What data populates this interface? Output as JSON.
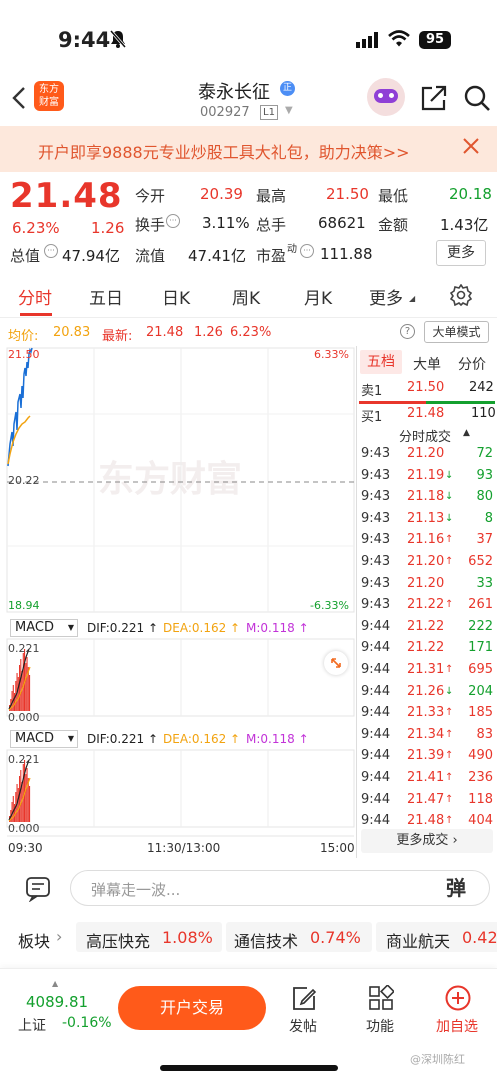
{
  "status": {
    "time": "9:44",
    "battery": "95"
  },
  "nav": {
    "name": "泰永长征",
    "badge": "正",
    "code": "002927",
    "level": "L1"
  },
  "banner": {
    "text": "开户即享9888元专业炒股工具大礼包，助力决策>>"
  },
  "quote": {
    "price": "21.48",
    "pct": "6.23%",
    "chg": "1.26",
    "rows": [
      [
        {
          "label": "今开",
          "value": "20.39",
          "color": "red"
        },
        {
          "label": "最高",
          "value": "21.50",
          "color": "red"
        },
        {
          "label": "最低",
          "value": "20.18",
          "color": "green"
        }
      ],
      [
        {
          "label": "换手",
          "value": "3.11%",
          "color": "dark"
        },
        {
          "label": "总手",
          "value": "68621",
          "color": "dark"
        },
        {
          "label": "金额",
          "value": "1.43亿",
          "color": "dark"
        }
      ],
      [
        {
          "label": "总值",
          "value": "47.94亿",
          "color": "dark"
        },
        {
          "label": "流值",
          "value": "47.41亿",
          "color": "dark"
        },
        {
          "label": "市盈",
          "sup": "动",
          "value": "111.88",
          "color": "dark"
        }
      ]
    ],
    "more": "更多"
  },
  "tabs": [
    "分时",
    "五日",
    "日K",
    "周K",
    "月K",
    "更多"
  ],
  "avg": {
    "avg_label": "均价:",
    "avg_value": "20.83",
    "last_label": "最新:",
    "last_value": "21.48",
    "chg": "1.26",
    "pct": "6.23%",
    "bigorder": "大单模式"
  },
  "chart": {
    "y_top": "21.50",
    "y_mid": "20.22",
    "y_bot": "18.94",
    "pct_top": "6.33%",
    "pct_bot": "-6.33%",
    "macd": {
      "name": "MACD",
      "dif": "DIF:0.221 ↑",
      "dea": "DEA:0.162 ↑",
      "m": "M:0.118 ↑",
      "y_top": "0.221",
      "y_bot": "0.000"
    },
    "x_labels": [
      "09:30",
      "11:30/13:00",
      "15:00"
    ],
    "watermark": "东方财富"
  },
  "side": {
    "tabs": [
      "五档",
      "大单",
      "分价"
    ],
    "sell": {
      "label": "卖1",
      "price": "21.50",
      "vol": "242"
    },
    "buy": {
      "label": "买1",
      "price": "21.48",
      "vol": "110"
    },
    "trades_title": "分时成交",
    "trades": [
      {
        "t": "9:43",
        "p": "21.20",
        "a": "",
        "v": "72",
        "c": "green"
      },
      {
        "t": "9:43",
        "p": "21.19",
        "a": "↓",
        "v": "93",
        "c": "green"
      },
      {
        "t": "9:43",
        "p": "21.18",
        "a": "↓",
        "v": "80",
        "c": "green"
      },
      {
        "t": "9:43",
        "p": "21.13",
        "a": "↓",
        "v": "8",
        "c": "green"
      },
      {
        "t": "9:43",
        "p": "21.16",
        "a": "↑",
        "v": "37",
        "c": "red"
      },
      {
        "t": "9:43",
        "p": "21.20",
        "a": "↑",
        "v": "652",
        "c": "red"
      },
      {
        "t": "9:43",
        "p": "21.20",
        "a": "",
        "v": "33",
        "c": "green"
      },
      {
        "t": "9:43",
        "p": "21.22",
        "a": "↑",
        "v": "261",
        "c": "red"
      },
      {
        "t": "9:44",
        "p": "21.22",
        "a": "",
        "v": "222",
        "c": "green"
      },
      {
        "t": "9:44",
        "p": "21.22",
        "a": "",
        "v": "171",
        "c": "green"
      },
      {
        "t": "9:44",
        "p": "21.31",
        "a": "↑",
        "v": "695",
        "c": "red"
      },
      {
        "t": "9:44",
        "p": "21.26",
        "a": "↓",
        "v": "204",
        "c": "green"
      },
      {
        "t": "9:44",
        "p": "21.33",
        "a": "↑",
        "v": "185",
        "c": "red"
      },
      {
        "t": "9:44",
        "p": "21.34",
        "a": "↑",
        "v": "83",
        "c": "red"
      },
      {
        "t": "9:44",
        "p": "21.39",
        "a": "↑",
        "v": "490",
        "c": "red"
      },
      {
        "t": "9:44",
        "p": "21.41",
        "a": "↑",
        "v": "236",
        "c": "red"
      },
      {
        "t": "9:44",
        "p": "21.47",
        "a": "↑",
        "v": "118",
        "c": "red"
      },
      {
        "t": "9:44",
        "p": "21.48",
        "a": "↑",
        "v": "404",
        "c": "red"
      }
    ],
    "more": "更多成交 ›"
  },
  "comment": {
    "placeholder": "弹幕走一波...",
    "danmu": "弹"
  },
  "sectors": {
    "label": "板块",
    "items": [
      {
        "name": "高压快充",
        "pct": "1.08%"
      },
      {
        "name": "通信技术",
        "pct": "0.74%"
      },
      {
        "name": "商业航天",
        "pct": "0.42"
      }
    ]
  },
  "footer": {
    "index_value": "4089.81",
    "index_name": "上证",
    "index_pct": "-0.16%",
    "open": "开户交易",
    "post": "发帖",
    "func": "功能",
    "add": "加自选",
    "watermark": "@深圳陈红"
  },
  "colors": {
    "red": "#e8362b",
    "green": "#14a02e",
    "blue": "#1a6fd6",
    "orange": "#f2a310",
    "brand": "#ff5a1a"
  }
}
